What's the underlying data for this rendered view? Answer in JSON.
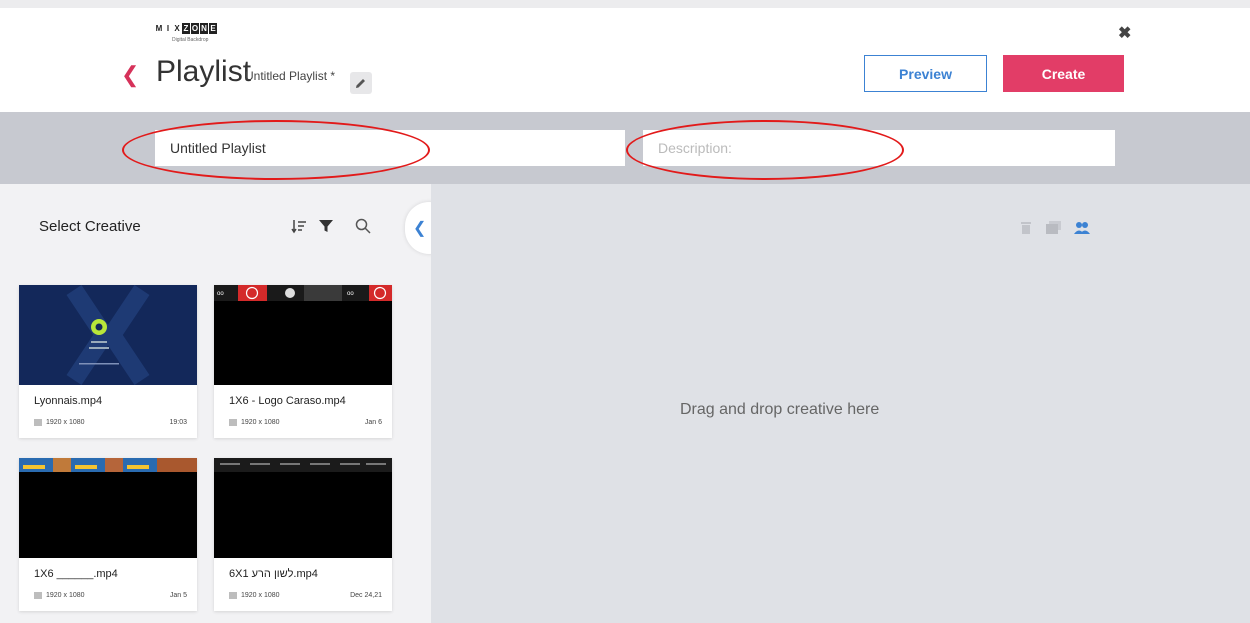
{
  "header": {
    "logo_letters": [
      "M",
      "I",
      "X",
      "Z",
      "O",
      "N",
      "E"
    ],
    "logo_sub": "Digital Backdrop",
    "title": "Playlist",
    "subtitle": "Untitled Playlist *",
    "preview_label": "Preview",
    "create_label": "Create"
  },
  "form": {
    "name_value": "Untitled Playlist",
    "description_placeholder": "Description:"
  },
  "sidebar": {
    "title": "Select Creative",
    "icons": [
      "sort-icon",
      "filter-icon",
      "search-icon"
    ]
  },
  "creatives": [
    {
      "name": "Lyonnais.mp4",
      "resolution": "1920 x 1080",
      "date": "19:03"
    },
    {
      "name": "1X6 - Logo Caraso.mp4",
      "resolution": "1920 x 1080",
      "date": "Jan 6"
    },
    {
      "name": "1X6 ______.mp4",
      "resolution": "1920 x 1080",
      "date": "Jan 5"
    },
    {
      "name": "6X1 לשון הרע.mp4",
      "resolution": "1920 x 1080",
      "date": "Dec 24,21"
    }
  ],
  "workspace": {
    "drop_text": "Drag and drop creative here",
    "icons": [
      "trash-icon",
      "layers-icon",
      "users-icon"
    ]
  },
  "colors": {
    "accent_blue": "#3c82d3",
    "create_red": "#e23d67",
    "annotation_red": "#e21a1a"
  }
}
